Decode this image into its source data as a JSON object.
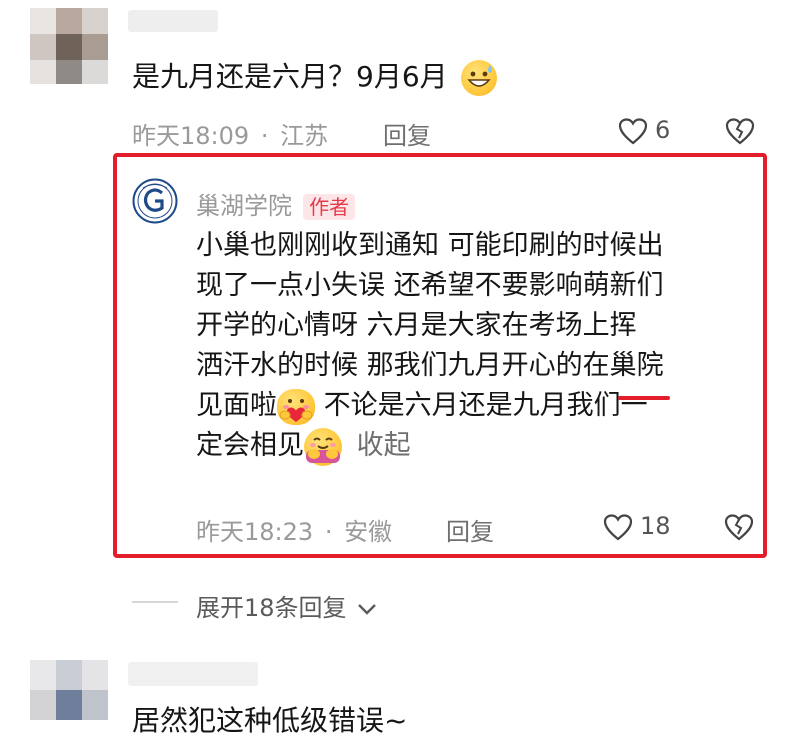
{
  "comments": [
    {
      "text": "是九月还是六月？9月6月",
      "time": "昨天18:09",
      "sep": "·",
      "location": "江苏",
      "reply_label": "回复",
      "likes": "6"
    },
    {
      "text": "居然犯这种低级错误~"
    }
  ],
  "author_reply": {
    "name": "巢湖学院",
    "tag": "作者",
    "lines": [
      "小巢也刚刚收到通知 可能印刷的时候出",
      "现了一点小失误 还希望不要影响萌新们",
      "开学的心情呀  六月是大家在考场上挥",
      "洒汗水的时候 那我们九月开心的在巢院"
    ],
    "line5_a": "见面啦",
    "line5_b": " 不论是六月还是九月我们一",
    "line6_a": "定会相见",
    "collapse_label": "收起",
    "time": "昨天18:23",
    "sep": "·",
    "location": "安徽",
    "reply_label": "回复",
    "likes": "18"
  },
  "expand_label": "展开18条回复",
  "colors": {
    "highlight_border": "#e41d2a",
    "author_tag": "#e33b4a",
    "meta_text": "#9a9a9a"
  },
  "icons": [
    "heart-outline-icon",
    "broken-heart-icon",
    "chevron-down-icon",
    "school-logo-icon",
    "grinning-sweat-emoji",
    "hug-emoji",
    "hugging-face-emoji"
  ]
}
